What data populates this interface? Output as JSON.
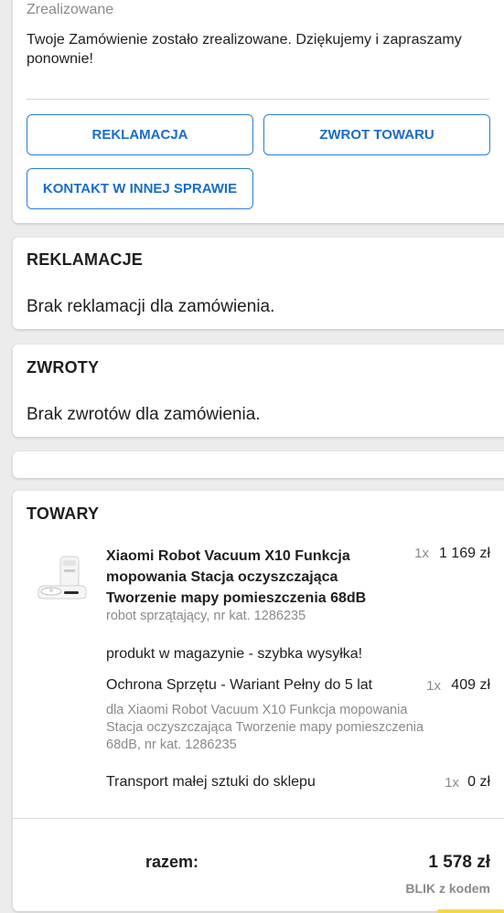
{
  "status": {
    "label": "Zrealizowane",
    "message": "Twoje Zamówienie zostało zrealizowane. Dziękujemy i zapraszamy ponownie!"
  },
  "actions": {
    "reklamacja": "REKLAMACJA",
    "zwrot": "ZWROT TOWARU",
    "kontakt": "KONTAKT W INNEJ SPRAWIE"
  },
  "reklamacje": {
    "title": "REKLAMACJE",
    "empty_text": "Brak reklamacji dla zamówienia."
  },
  "zwroty": {
    "title": "ZWROTY",
    "empty_text": "Brak zwrotów dla zamówienia."
  },
  "towary": {
    "title": "TOWARY",
    "product": {
      "icon": "robot-vacuum-image",
      "name": "Xiaomi Robot Vacuum X10 Funkcja mopowania Stacja oczyszczająca Tworzenie mapy pomieszczenia 68dB",
      "subtitle": "robot sprzątający, nr kat. 1286235",
      "qty": "1x",
      "price": "1 169 zł",
      "availability": "produkt w magazynie - szybka wysyłka!"
    },
    "addons": [
      {
        "name": "Ochrona Sprzętu - Wariant Pełny do 5 lat",
        "qty": "1x",
        "price": "409 zł",
        "detail": "dla Xiaomi Robot Vacuum X10 Funkcja mopowania Stacja oczyszczająca Tworzenie mapy pomieszczenia 68dB, nr kat. 1286235"
      },
      {
        "name": "Transport małej sztuki do sklepu",
        "qty": "1x",
        "price": "0 zł"
      }
    ],
    "total_label": "razem:",
    "total_value": "1 578 zł",
    "payment_method": "BLIK z kodem"
  },
  "colors": {
    "accent": "#1a6ccc",
    "background": "#ececec",
    "muted_text": "#8a8a8a"
  }
}
